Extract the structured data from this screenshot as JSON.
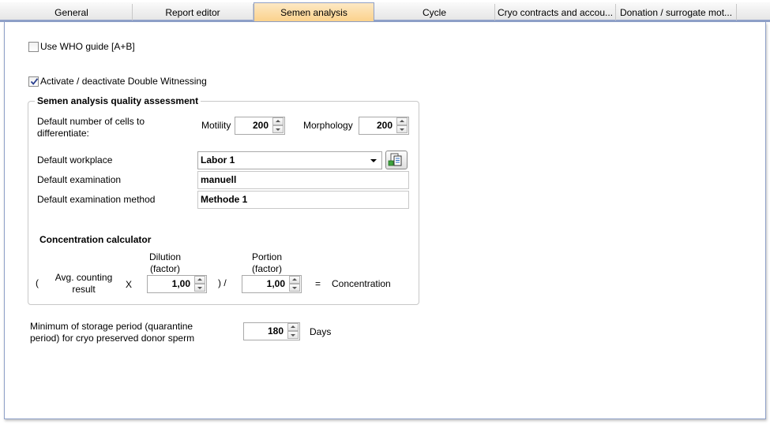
{
  "tabs": [
    {
      "label": "General"
    },
    {
      "label": "Report editor"
    },
    {
      "label": "Semen analysis",
      "active": true
    },
    {
      "label": "Cycle"
    },
    {
      "label": "Cryo contracts and accou..."
    },
    {
      "label": "Donation / surrogate mot..."
    }
  ],
  "options": {
    "who_guide": {
      "label": "Use WHO guide [A+B]",
      "checked": false
    },
    "double_witnessing": {
      "label": "Activate / deactivate Double Witnessing",
      "checked": true
    }
  },
  "quality": {
    "title": "Semen analysis quality assessment",
    "cells_label": "Default number of cells to differentiate:",
    "motility_label": "Motility",
    "motility_value": "200",
    "morphology_label": "Morphology",
    "morphology_value": "200",
    "workplace_label": "Default workplace",
    "workplace_value": "Labor 1",
    "examination_label": "Default examination",
    "examination_value": "manuell",
    "method_label": "Default examination method",
    "method_value": "Methode 1"
  },
  "calculator": {
    "title": "Concentration calculator",
    "open_paren": "(",
    "avg_label": "Avg. counting result",
    "times": "X",
    "dilution_label": "Dilution (factor)",
    "dilution_value": "1,00",
    "close_div": ") /",
    "portion_label": "Portion (factor)",
    "portion_value": "1,00",
    "equals": "=",
    "result_label": "Concentration"
  },
  "storage": {
    "label": "Minimum of storage period (quarantine period) for cryo preserved donor sperm",
    "value": "180",
    "unit": "Days"
  },
  "icons": {
    "workplace_button": "copy-document-icon"
  }
}
